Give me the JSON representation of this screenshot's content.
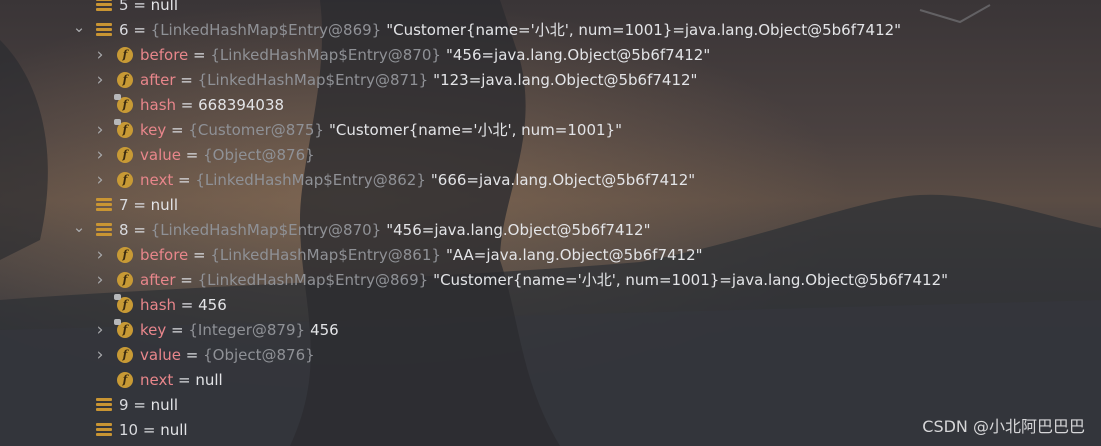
{
  "rows": [
    {
      "indent": 0,
      "chevron": "none",
      "icon": "array-icon",
      "name": "5",
      "type": "",
      "value": "null"
    },
    {
      "indent": 0,
      "chevron": "expanded",
      "icon": "array-icon",
      "name": "6",
      "type": "{LinkedHashMap$Entry@869}",
      "value": "\"Customer{name='小北', num=1001}=java.lang.Object@5b6f7412\""
    },
    {
      "indent": 1,
      "chevron": "collapsed",
      "icon": "field-icon",
      "name": "before",
      "type": "{LinkedHashMap$Entry@870}",
      "value": "\"456=java.lang.Object@5b6f7412\""
    },
    {
      "indent": 1,
      "chevron": "collapsed",
      "icon": "field-icon",
      "name": "after",
      "type": "{LinkedHashMap$Entry@871}",
      "value": "\"123=java.lang.Object@5b6f7412\""
    },
    {
      "indent": 1,
      "chevron": "none",
      "icon": "final-field-icon",
      "name": "hash",
      "type": "",
      "value": "668394038"
    },
    {
      "indent": 1,
      "chevron": "collapsed",
      "icon": "final-field-icon",
      "name": "key",
      "type": "{Customer@875}",
      "value": "\"Customer{name='小北', num=1001}\""
    },
    {
      "indent": 1,
      "chevron": "collapsed",
      "icon": "field-icon",
      "name": "value",
      "type": "{Object@876}",
      "value": ""
    },
    {
      "indent": 1,
      "chevron": "collapsed",
      "icon": "field-icon",
      "name": "next",
      "type": "{LinkedHashMap$Entry@862}",
      "value": "\"666=java.lang.Object@5b6f7412\""
    },
    {
      "indent": 0,
      "chevron": "none",
      "icon": "array-icon",
      "name": "7",
      "type": "",
      "value": "null"
    },
    {
      "indent": 0,
      "chevron": "expanded",
      "icon": "array-icon",
      "name": "8",
      "type": "{LinkedHashMap$Entry@870}",
      "value": "\"456=java.lang.Object@5b6f7412\""
    },
    {
      "indent": 1,
      "chevron": "collapsed",
      "icon": "field-icon",
      "name": "before",
      "type": "{LinkedHashMap$Entry@861}",
      "value": "\"AA=java.lang.Object@5b6f7412\""
    },
    {
      "indent": 1,
      "chevron": "collapsed",
      "icon": "field-icon",
      "name": "after",
      "type": "{LinkedHashMap$Entry@869}",
      "value": "\"Customer{name='小北', num=1001}=java.lang.Object@5b6f7412\""
    },
    {
      "indent": 1,
      "chevron": "none",
      "icon": "final-field-icon",
      "name": "hash",
      "type": "",
      "value": "456"
    },
    {
      "indent": 1,
      "chevron": "collapsed",
      "icon": "final-field-icon",
      "name": "key",
      "type": "{Integer@879}",
      "value": "456"
    },
    {
      "indent": 1,
      "chevron": "collapsed",
      "icon": "field-icon",
      "name": "value",
      "type": "{Object@876}",
      "value": ""
    },
    {
      "indent": 1,
      "chevron": "none",
      "icon": "field-icon",
      "name": "next",
      "type": "",
      "value": "null"
    },
    {
      "indent": 0,
      "chevron": "none",
      "icon": "array-icon",
      "name": "9",
      "type": "",
      "value": "null"
    },
    {
      "indent": 0,
      "chevron": "none",
      "icon": "array-icon",
      "name": "10",
      "type": "",
      "value": "null"
    }
  ],
  "watermark": "CSDN @小北阿巴巴巴",
  "colors": {
    "field_name": "#e8868b",
    "type_ref": "#8f9196",
    "value": "#e3e4e7",
    "icon": "#c89a35"
  }
}
